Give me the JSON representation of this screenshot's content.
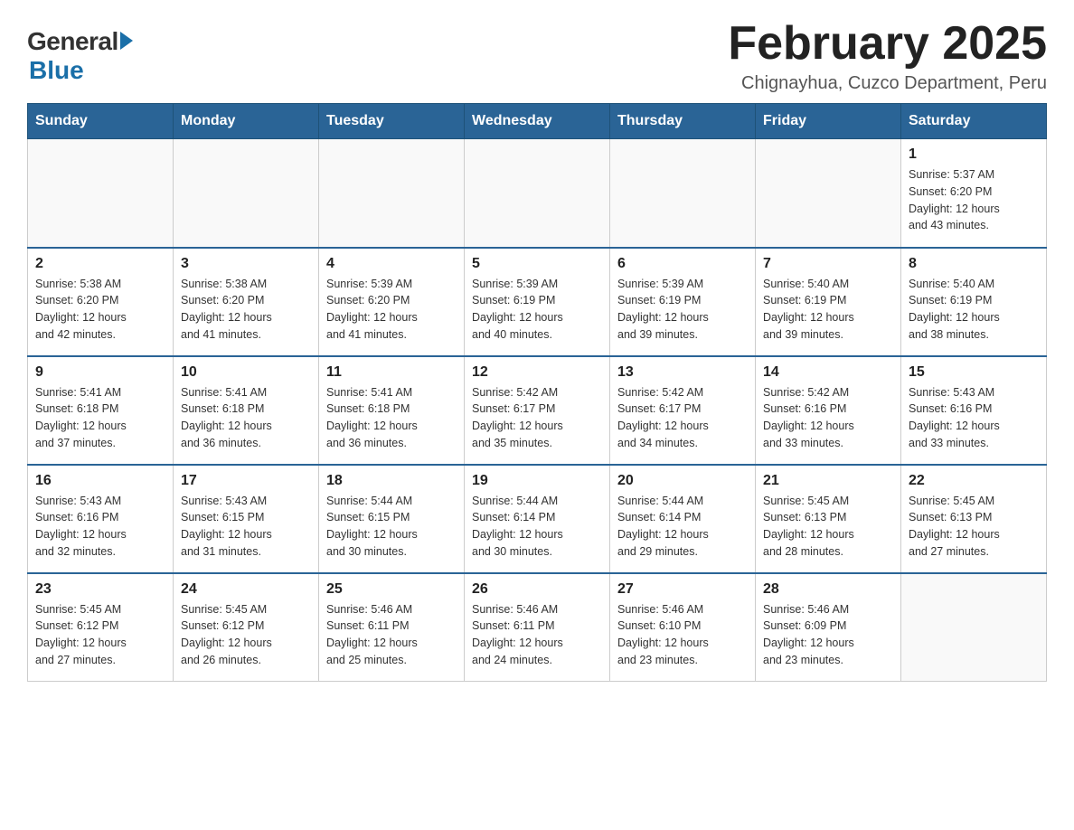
{
  "header": {
    "logo": {
      "general": "General",
      "blue": "Blue"
    },
    "title": "February 2025",
    "location": "Chignayhua, Cuzco Department, Peru"
  },
  "weekdays": [
    "Sunday",
    "Monday",
    "Tuesday",
    "Wednesday",
    "Thursday",
    "Friday",
    "Saturday"
  ],
  "weeks": [
    [
      {
        "day": "",
        "info": ""
      },
      {
        "day": "",
        "info": ""
      },
      {
        "day": "",
        "info": ""
      },
      {
        "day": "",
        "info": ""
      },
      {
        "day": "",
        "info": ""
      },
      {
        "day": "",
        "info": ""
      },
      {
        "day": "1",
        "info": "Sunrise: 5:37 AM\nSunset: 6:20 PM\nDaylight: 12 hours\nand 43 minutes."
      }
    ],
    [
      {
        "day": "2",
        "info": "Sunrise: 5:38 AM\nSunset: 6:20 PM\nDaylight: 12 hours\nand 42 minutes."
      },
      {
        "day": "3",
        "info": "Sunrise: 5:38 AM\nSunset: 6:20 PM\nDaylight: 12 hours\nand 41 minutes."
      },
      {
        "day": "4",
        "info": "Sunrise: 5:39 AM\nSunset: 6:20 PM\nDaylight: 12 hours\nand 41 minutes."
      },
      {
        "day": "5",
        "info": "Sunrise: 5:39 AM\nSunset: 6:19 PM\nDaylight: 12 hours\nand 40 minutes."
      },
      {
        "day": "6",
        "info": "Sunrise: 5:39 AM\nSunset: 6:19 PM\nDaylight: 12 hours\nand 39 minutes."
      },
      {
        "day": "7",
        "info": "Sunrise: 5:40 AM\nSunset: 6:19 PM\nDaylight: 12 hours\nand 39 minutes."
      },
      {
        "day": "8",
        "info": "Sunrise: 5:40 AM\nSunset: 6:19 PM\nDaylight: 12 hours\nand 38 minutes."
      }
    ],
    [
      {
        "day": "9",
        "info": "Sunrise: 5:41 AM\nSunset: 6:18 PM\nDaylight: 12 hours\nand 37 minutes."
      },
      {
        "day": "10",
        "info": "Sunrise: 5:41 AM\nSunset: 6:18 PM\nDaylight: 12 hours\nand 36 minutes."
      },
      {
        "day": "11",
        "info": "Sunrise: 5:41 AM\nSunset: 6:18 PM\nDaylight: 12 hours\nand 36 minutes."
      },
      {
        "day": "12",
        "info": "Sunrise: 5:42 AM\nSunset: 6:17 PM\nDaylight: 12 hours\nand 35 minutes."
      },
      {
        "day": "13",
        "info": "Sunrise: 5:42 AM\nSunset: 6:17 PM\nDaylight: 12 hours\nand 34 minutes."
      },
      {
        "day": "14",
        "info": "Sunrise: 5:42 AM\nSunset: 6:16 PM\nDaylight: 12 hours\nand 33 minutes."
      },
      {
        "day": "15",
        "info": "Sunrise: 5:43 AM\nSunset: 6:16 PM\nDaylight: 12 hours\nand 33 minutes."
      }
    ],
    [
      {
        "day": "16",
        "info": "Sunrise: 5:43 AM\nSunset: 6:16 PM\nDaylight: 12 hours\nand 32 minutes."
      },
      {
        "day": "17",
        "info": "Sunrise: 5:43 AM\nSunset: 6:15 PM\nDaylight: 12 hours\nand 31 minutes."
      },
      {
        "day": "18",
        "info": "Sunrise: 5:44 AM\nSunset: 6:15 PM\nDaylight: 12 hours\nand 30 minutes."
      },
      {
        "day": "19",
        "info": "Sunrise: 5:44 AM\nSunset: 6:14 PM\nDaylight: 12 hours\nand 30 minutes."
      },
      {
        "day": "20",
        "info": "Sunrise: 5:44 AM\nSunset: 6:14 PM\nDaylight: 12 hours\nand 29 minutes."
      },
      {
        "day": "21",
        "info": "Sunrise: 5:45 AM\nSunset: 6:13 PM\nDaylight: 12 hours\nand 28 minutes."
      },
      {
        "day": "22",
        "info": "Sunrise: 5:45 AM\nSunset: 6:13 PM\nDaylight: 12 hours\nand 27 minutes."
      }
    ],
    [
      {
        "day": "23",
        "info": "Sunrise: 5:45 AM\nSunset: 6:12 PM\nDaylight: 12 hours\nand 27 minutes."
      },
      {
        "day": "24",
        "info": "Sunrise: 5:45 AM\nSunset: 6:12 PM\nDaylight: 12 hours\nand 26 minutes."
      },
      {
        "day": "25",
        "info": "Sunrise: 5:46 AM\nSunset: 6:11 PM\nDaylight: 12 hours\nand 25 minutes."
      },
      {
        "day": "26",
        "info": "Sunrise: 5:46 AM\nSunset: 6:11 PM\nDaylight: 12 hours\nand 24 minutes."
      },
      {
        "day": "27",
        "info": "Sunrise: 5:46 AM\nSunset: 6:10 PM\nDaylight: 12 hours\nand 23 minutes."
      },
      {
        "day": "28",
        "info": "Sunrise: 5:46 AM\nSunset: 6:09 PM\nDaylight: 12 hours\nand 23 minutes."
      },
      {
        "day": "",
        "info": ""
      }
    ]
  ]
}
